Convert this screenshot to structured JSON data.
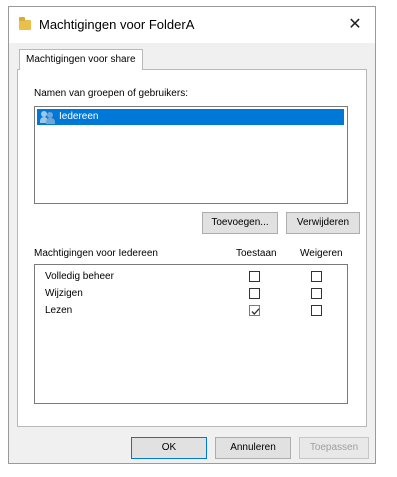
{
  "background_text": "....................",
  "dialog": {
    "title": "Machtigingen voor FolderA",
    "close_glyph": "✕",
    "tab_label": "Machtigingen voor share",
    "groups_label": "Namen van groepen of gebruikers:",
    "users": [
      {
        "name": "Iedereen",
        "selected": true
      }
    ],
    "add_button": "Toevoegen...",
    "remove_button": "Verwijderen",
    "permissions_label": "Machtigingen voor Iedereen",
    "allow_header": "Toestaan",
    "deny_header": "Weigeren",
    "permissions": [
      {
        "name": "Volledig beheer",
        "allow": false,
        "deny": false
      },
      {
        "name": "Wijzigen",
        "allow": false,
        "deny": false
      },
      {
        "name": "Lezen",
        "allow": true,
        "deny": false
      }
    ],
    "ok_button": "OK",
    "cancel_button": "Annuleren",
    "apply_button": "Toepassen"
  },
  "colors": {
    "selection": "#0078d7",
    "dialog_bg": "#f0f0f0",
    "default_border": "#0078d7"
  }
}
